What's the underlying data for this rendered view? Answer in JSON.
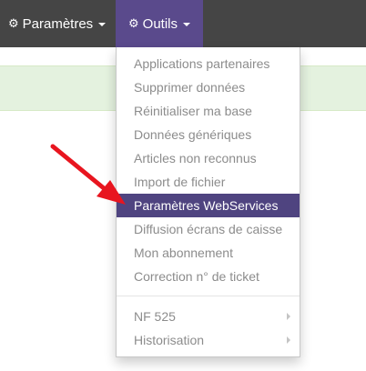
{
  "navbar": {
    "params_label": "Paramètres",
    "outils_label": "Outils",
    "params_icon": "gear-icon",
    "outils_icon": "gear-icon"
  },
  "dropdown": {
    "items": [
      {
        "label": "Applications partenaires"
      },
      {
        "label": "Supprimer données"
      },
      {
        "label": "Réinitialiser ma base"
      },
      {
        "label": "Données génériques"
      },
      {
        "label": "Articles non reconnus"
      },
      {
        "label": "Import de fichier"
      },
      {
        "label": "Paramètres WebServices",
        "active": true
      },
      {
        "label": "Diffusion écrans de caisse"
      },
      {
        "label": "Mon abonnement"
      },
      {
        "label": "Correction n° de ticket"
      }
    ],
    "submenus": [
      {
        "label": "NF 525"
      },
      {
        "label": "Historisation"
      }
    ]
  },
  "colors": {
    "navbar": "#454545",
    "active_nav": "#5a4a8c",
    "active_item": "#4f4480",
    "alert_strip": "#e4f2df",
    "arrow": "#e8151f"
  }
}
